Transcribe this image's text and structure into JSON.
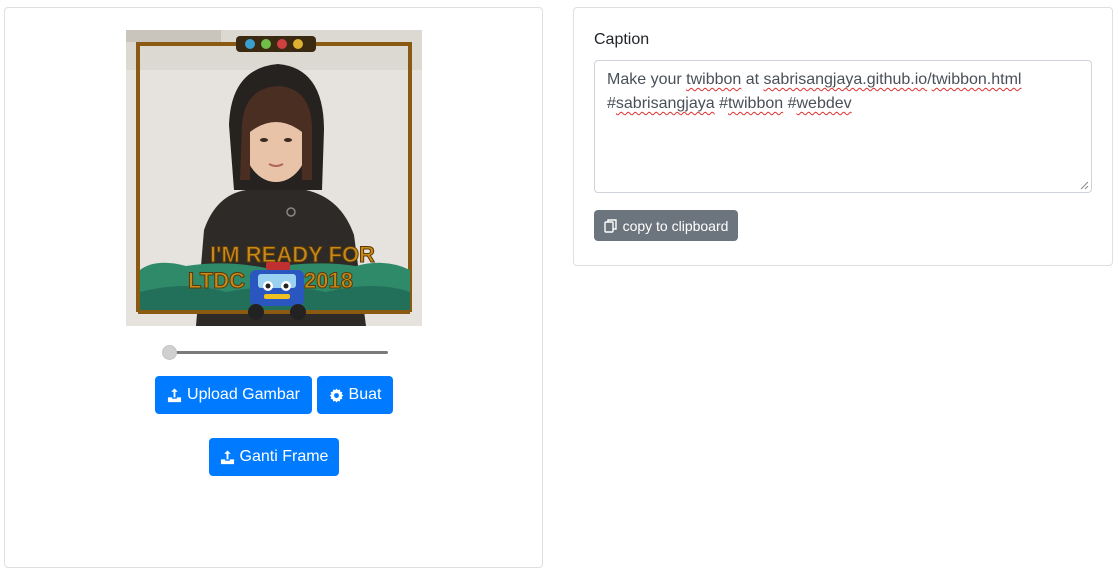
{
  "editor": {
    "canvas": {
      "frame_text_line1": "I'M READY FOR",
      "frame_text_ltdc": "LTDC",
      "frame_text_year": "2018"
    },
    "zoom_slider": {
      "value_fraction": 0.0
    },
    "upload_button": {
      "label": "Upload Gambar",
      "icon": "upload-icon"
    },
    "create_button": {
      "label": "Buat",
      "icon": "gear-icon"
    },
    "change_frame_button": {
      "label": "Ganti Frame",
      "icon": "upload-icon"
    }
  },
  "caption": {
    "label": "Caption",
    "line1_words": [
      "Make your ",
      "twibbon",
      " at ",
      "sabrisangjaya.github.io",
      "/",
      "twibbon.html"
    ],
    "line2_words": [
      "#",
      "sabrisangjaya",
      " #",
      "twibbon",
      " #",
      "webdev"
    ],
    "copy_button": {
      "label": "copy to clipboard",
      "icon": "copy-icon"
    }
  },
  "colors": {
    "primary": "#007bff",
    "secondary": "#6c757d",
    "frame_brown": "#8a5a12",
    "frame_green": "#2f8a6a"
  }
}
